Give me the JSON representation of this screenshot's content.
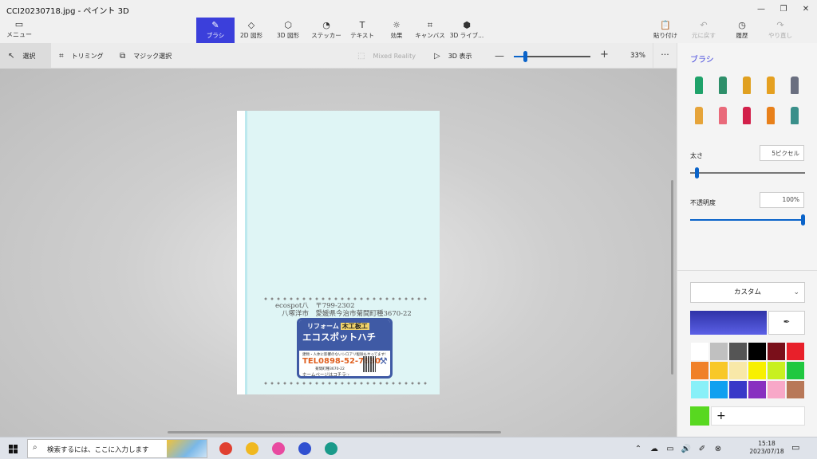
{
  "window": {
    "title": "CCI20230718.jpg - ペイント 3D",
    "controls": [
      "—",
      "❐",
      "✕"
    ]
  },
  "menu": {
    "label": "メニュー",
    "icon": "folder-icon"
  },
  "tools": [
    {
      "label": "ブラシ",
      "icon": "brush-icon",
      "active": true
    },
    {
      "label": "2D 図形",
      "icon": "2d-shapes-icon"
    },
    {
      "label": "3D 図形",
      "icon": "3d-shapes-icon"
    },
    {
      "label": "ステッカー",
      "icon": "sticker-icon"
    },
    {
      "label": "テキスト",
      "icon": "text-icon"
    },
    {
      "label": "効果",
      "icon": "effects-icon"
    },
    {
      "label": "キャンバス",
      "icon": "canvas-icon"
    },
    {
      "label": "3D ライブ...",
      "icon": "3d-library-icon"
    }
  ],
  "right_tools": [
    {
      "label": "貼り付け",
      "icon": "paste-icon"
    },
    {
      "label": "元に戻す",
      "icon": "undo-icon",
      "disabled": true
    },
    {
      "label": "履歴",
      "icon": "history-icon"
    },
    {
      "label": "やり直し",
      "icon": "redo-icon",
      "disabled": true
    }
  ],
  "subtoolbar": {
    "select": "選択",
    "trim": "トリミング",
    "magic_select": "マジック選択",
    "mixed_reality": "Mixed Reality",
    "view_3d": "3D 表示",
    "zoom_value": "33%",
    "zoom_fraction": 0.15,
    "more": "···"
  },
  "document": {
    "address_line1": "ecospot八　〒799-2302",
    "address_line2": "八塚洋市　愛媛県今治市菊間町種3670-22",
    "ad": {
      "header": "リフォーム",
      "tag": "木工板工",
      "name": "エコスポットハチ",
      "sub": "建物・人体に影響のないシロアリ駆除もやってます!",
      "tel": "TEL0898-52-7830",
      "addr": "菊間町種3670-22",
      "homepage": "ホームページはコチラ☞"
    }
  },
  "panel": {
    "title": "ブラシ",
    "brushes": [
      {
        "icon": "marker-icon",
        "color": "#1fa26a"
      },
      {
        "icon": "calligraphy-pen-icon",
        "color": "#2e8f6a"
      },
      {
        "icon": "oil-brush-icon",
        "color": "#e0a020"
      },
      {
        "icon": "watercolor-icon",
        "color": "#e5a020"
      },
      {
        "icon": "pixel-pen-icon",
        "color": "#6a6f80"
      },
      {
        "icon": "pencil-icon",
        "color": "#e6a43a"
      },
      {
        "icon": "eraser-icon",
        "color": "#e96a7a"
      },
      {
        "icon": "crayon-icon",
        "color": "#d2204a"
      },
      {
        "icon": "spray-can-icon",
        "color": "#e8801a"
      },
      {
        "icon": "fill-icon",
        "color": "#3a8f8a"
      }
    ],
    "size_label": "太さ",
    "size_value": "5ピクセル",
    "size_fraction": 0.04,
    "opacity_label": "不透明度",
    "opacity_value": "100%",
    "opacity_fraction": 1.0,
    "color_mode": "カスタム",
    "swatches": [
      "#ffffff",
      "#c0c0c0",
      "#555555",
      "#000000",
      "#7a0f1a",
      "#e8202a",
      "#f08028",
      "#f8c828",
      "#f8e8a8",
      "#f8f000",
      "#c8f020",
      "#20c840",
      "#88f0f8",
      "#10a0f0",
      "#3838c8",
      "#8830c0",
      "#f8a8c8",
      "#b87858"
    ],
    "custom_color": "#58d820",
    "add_label": "+"
  },
  "taskbar": {
    "search_placeholder": "検索するには、ここに入力します",
    "time": "15:18",
    "date": "2023/07/18",
    "apps": [
      {
        "icon": "chrome-icon",
        "color": "#e04030"
      },
      {
        "icon": "file-explorer-icon",
        "color": "#f0b820"
      },
      {
        "icon": "paint-3d-icon",
        "color": "#e84aa0"
      },
      {
        "icon": "headset-icon",
        "color": "#3050d0"
      },
      {
        "icon": "edge-icon",
        "color": "#1a9a8a"
      }
    ]
  }
}
